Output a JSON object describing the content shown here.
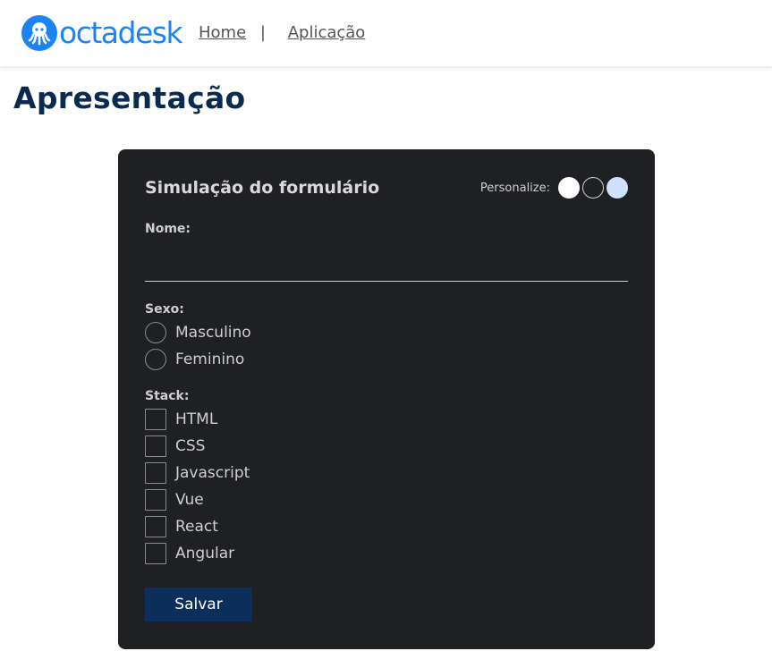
{
  "header": {
    "logo_text": "octadesk",
    "logo_icon": "octopus-icon",
    "nav": [
      {
        "label": "Home"
      },
      {
        "label": "Aplicação"
      }
    ],
    "separator": "|"
  },
  "page": {
    "title": "Apresentação"
  },
  "form": {
    "title": "Simulação do formulário",
    "personalize_label": "Personalize:",
    "swatches": [
      "#ffffff",
      "#1f2024",
      "#cfe2fb"
    ],
    "name_label": "Nome:",
    "name_value": "",
    "sex_label": "Sexo:",
    "sex_options": [
      "Masculino",
      "Feminino"
    ],
    "stack_label": "Stack:",
    "stack_options": [
      "HTML",
      "CSS",
      "Javascript",
      "Vue",
      "React",
      "Angular"
    ],
    "save_label": "Salvar"
  },
  "colors": {
    "brand": "#1b84f5",
    "title": "#0b2a4f",
    "card_bg": "#1f2024",
    "button_bg": "#0c2e5a"
  }
}
